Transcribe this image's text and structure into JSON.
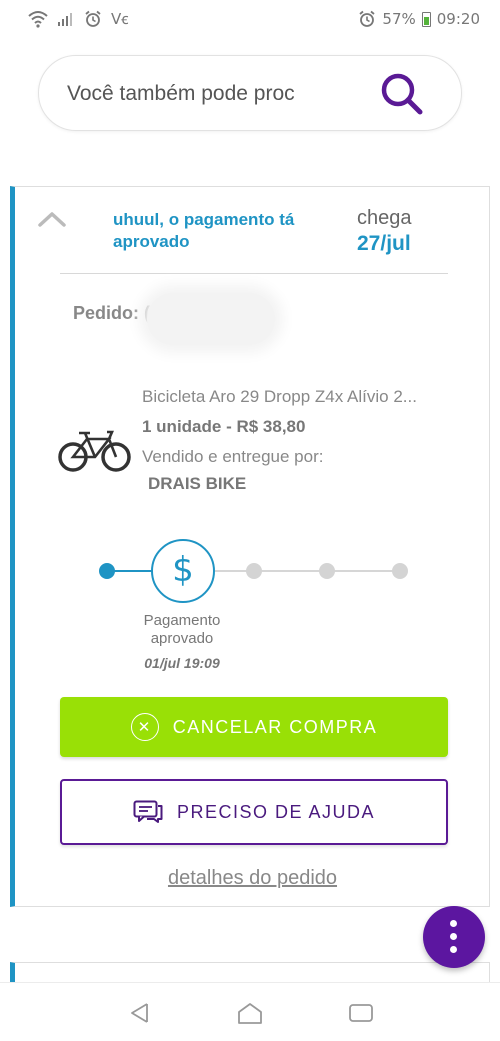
{
  "status_bar": {
    "carrier_text": "Vꞓ",
    "battery_percent": "57%",
    "time": "09:20",
    "icons": [
      "wifi-icon",
      "signal-icon",
      "alarm-icon",
      "alarm-icon",
      "battery-icon"
    ]
  },
  "search": {
    "placeholder": "Você também pode proc",
    "icon": "search-icon",
    "accent_color": "#5a1a95"
  },
  "order_card": {
    "accent_color": "#1f94c4",
    "status_title": "uhuul, o pagamento tá aprovado",
    "arrival_label": "chega",
    "arrival_date": "27/jul",
    "order_label": "Pedido: (",
    "product": {
      "name": "Bicicleta Aro 29 Dropp Z4x Alívio 2...",
      "quantity_price": "1 unidade - R$ 38,80",
      "seller_label": "Vendido e entregue por:",
      "seller_name": "DRAIS BIKE",
      "image": "bicycle-image"
    },
    "progress": {
      "current_step": 1,
      "total_steps": 5,
      "step_icon": "$",
      "step_label": "Pagamento aprovado",
      "step_date": "01/jul 19:09"
    },
    "cancel_button": {
      "label": "CANCELAR COMPRA",
      "icon": "cancel-icon",
      "color": "#99e006"
    },
    "help_button": {
      "label": "PRECISO DE AJUDA",
      "icon": "chat-icon",
      "color": "#5a1a95"
    },
    "details_link": "detalhes do pedido"
  },
  "fab": {
    "icon": "more-vertical-icon",
    "color": "#5c16a0"
  },
  "nav_bar": {
    "buttons": [
      "back-icon",
      "home-icon",
      "recents-icon"
    ]
  }
}
